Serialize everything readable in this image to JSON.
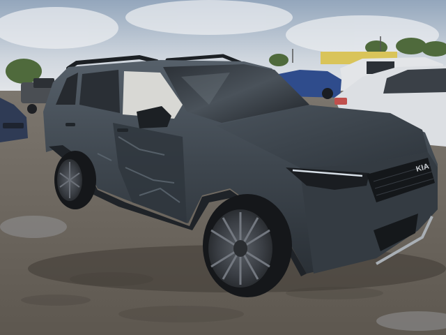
{
  "photo": {
    "grille_badge_text": "KIA"
  },
  "colors": {
    "sky_top": "#9fb0c4",
    "sky_bottom": "#dfe3e8",
    "ground": "#6b645c",
    "suv_body": "#3d454d",
    "suv_shadow": "#262b31",
    "white_car": "#dcdfe3",
    "blue_car": "#2f4c8c",
    "trees": "#4f6a3c"
  }
}
